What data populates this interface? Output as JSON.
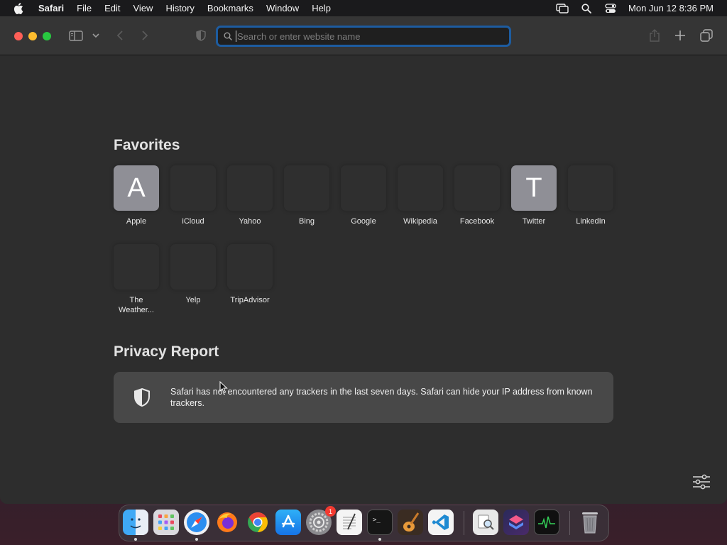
{
  "menubar": {
    "app_name": "Safari",
    "items": [
      "File",
      "Edit",
      "View",
      "History",
      "Bookmarks",
      "Window",
      "Help"
    ],
    "clock": "Mon Jun 12  8:36 PM"
  },
  "toolbar": {
    "url_placeholder": "Search or enter website name",
    "url_value": ""
  },
  "favorites": {
    "title": "Favorites",
    "items": [
      {
        "label": "Apple",
        "letter": "A"
      },
      {
        "label": "iCloud",
        "letter": ""
      },
      {
        "label": "Yahoo",
        "letter": ""
      },
      {
        "label": "Bing",
        "letter": ""
      },
      {
        "label": "Google",
        "letter": ""
      },
      {
        "label": "Wikipedia",
        "letter": ""
      },
      {
        "label": "Facebook",
        "letter": ""
      },
      {
        "label": "Twitter",
        "letter": "T"
      },
      {
        "label": "LinkedIn",
        "letter": ""
      },
      {
        "label": "The Weather...",
        "letter": ""
      },
      {
        "label": "Yelp",
        "letter": ""
      },
      {
        "label": "TripAdvisor",
        "letter": ""
      }
    ]
  },
  "privacy": {
    "title": "Privacy Report",
    "message": "Safari has not encountered any trackers in the last seven days. Safari can hide your IP address from known trackers."
  },
  "dock": {
    "apps": [
      {
        "name": "Finder",
        "icon": "finder-icon",
        "running": true
      },
      {
        "name": "Launchpad",
        "icon": "launchpad-icon",
        "running": false
      },
      {
        "name": "Safari",
        "icon": "safari-icon",
        "running": true
      },
      {
        "name": "Firefox",
        "icon": "firefox-icon",
        "running": false
      },
      {
        "name": "Chrome",
        "icon": "chrome-icon",
        "running": false
      },
      {
        "name": "App Store",
        "icon": "app-store-icon",
        "running": false
      },
      {
        "name": "System Settings",
        "icon": "settings-icon",
        "running": false,
        "badge": "1"
      },
      {
        "name": "TextEdit",
        "icon": "textedit-icon",
        "running": false
      },
      {
        "name": "Terminal",
        "icon": "terminal-icon",
        "running": true
      },
      {
        "name": "GarageBand",
        "icon": "garageband-icon",
        "running": false
      },
      {
        "name": "VS Code",
        "icon": "vscode-icon",
        "running": false
      },
      {
        "name": "Preview",
        "icon": "preview-icon",
        "running": false
      },
      {
        "name": "Shortcuts",
        "icon": "shortcuts-icon",
        "running": false
      },
      {
        "name": "Activity Monitor",
        "icon": "activity-monitor-icon",
        "running": false
      },
      {
        "name": "Trash",
        "icon": "trash-icon",
        "running": false
      }
    ]
  },
  "colors": {
    "accent_focus": "#1d5ca0",
    "window_bg": "#2d2d2d",
    "toolbar_bg": "#353535",
    "tile_letter_bg": "#8f8f96"
  }
}
